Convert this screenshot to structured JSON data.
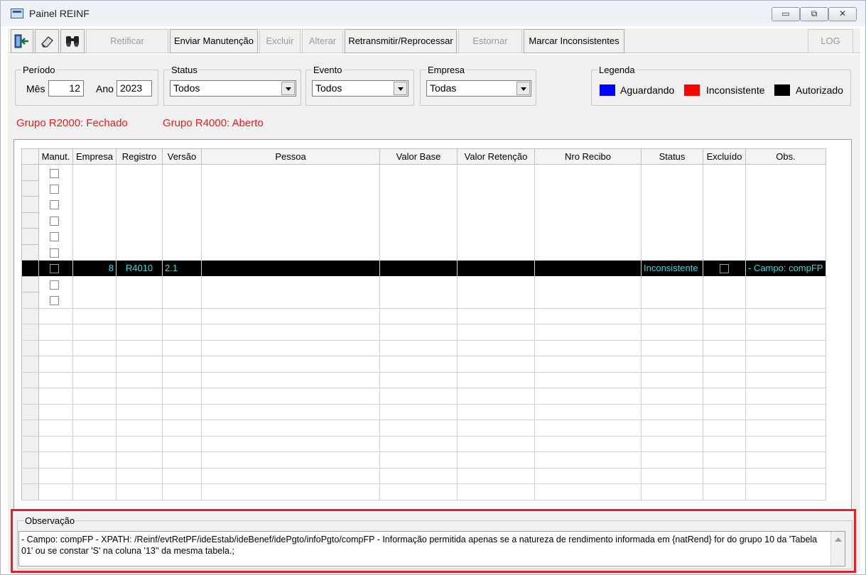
{
  "window": {
    "title": "Painel REINF",
    "controls": {
      "minimize": "▭",
      "restore": "⧉",
      "close": "✕"
    }
  },
  "toolbar": {
    "icons": [
      "exit-door-icon",
      "eraser-icon",
      "binoculars-icon"
    ],
    "buttons": {
      "retificar": "Retificar",
      "enviar": "Enviar Manutenção",
      "excluir": "Excluir",
      "alterar": "Alterar",
      "retransmitir": "Retransmitir/Reprocessar",
      "estornar": "Estornar",
      "marcar": "Marcar Inconsistentes",
      "log": "LOG"
    }
  },
  "filters": {
    "periodo": {
      "legend": "Período",
      "mes_label": "Mês",
      "mes": "12",
      "ano_label": "Ano",
      "ano": "2023"
    },
    "status": {
      "legend": "Status",
      "value": "Todos"
    },
    "evento": {
      "legend": "Evento",
      "value": "Todos"
    },
    "empresa": {
      "legend": "Empresa",
      "value": "Todas"
    },
    "legenda": {
      "legend": "Legenda",
      "items": [
        {
          "label": "Aguardando",
          "color": "#0000ff"
        },
        {
          "label": "Inconsistente",
          "color": "#ff0000"
        },
        {
          "label": "Autorizado",
          "color": "#000000"
        }
      ]
    }
  },
  "groups": {
    "r2000": "Grupo R2000: Fechado",
    "r4000": "Grupo R4000: Aberto"
  },
  "grid": {
    "columns": [
      "Manut.",
      "Empresa",
      "Registro",
      "Versão",
      "Pessoa",
      "Valor Base",
      "Valor Retenção",
      "Nro Recibo",
      "Status",
      "Excluído",
      "Obs."
    ],
    "selected_row": {
      "empresa": "8",
      "registro": "R4010",
      "versao": "2.1",
      "status": "Inconsistente",
      "obs": "- Campo: compFP"
    }
  },
  "observacao": {
    "legend": "Observação",
    "text": "- Campo: compFP - XPATH: /Reinf/evtRetPF/ideEstab/ideBenef/idePgto/infoPgto/compFP - Informação permitida apenas se a natureza de rendimento informada em {natRend} for do grupo 10 da 'Tabela 01' ou se constar 'S' na coluna '13'' da mesma tabela.;"
  },
  "colors": {
    "accent_red": "#e41c1c",
    "selected_text": "#28e0e0",
    "highlight_frame": "#e0222a"
  }
}
